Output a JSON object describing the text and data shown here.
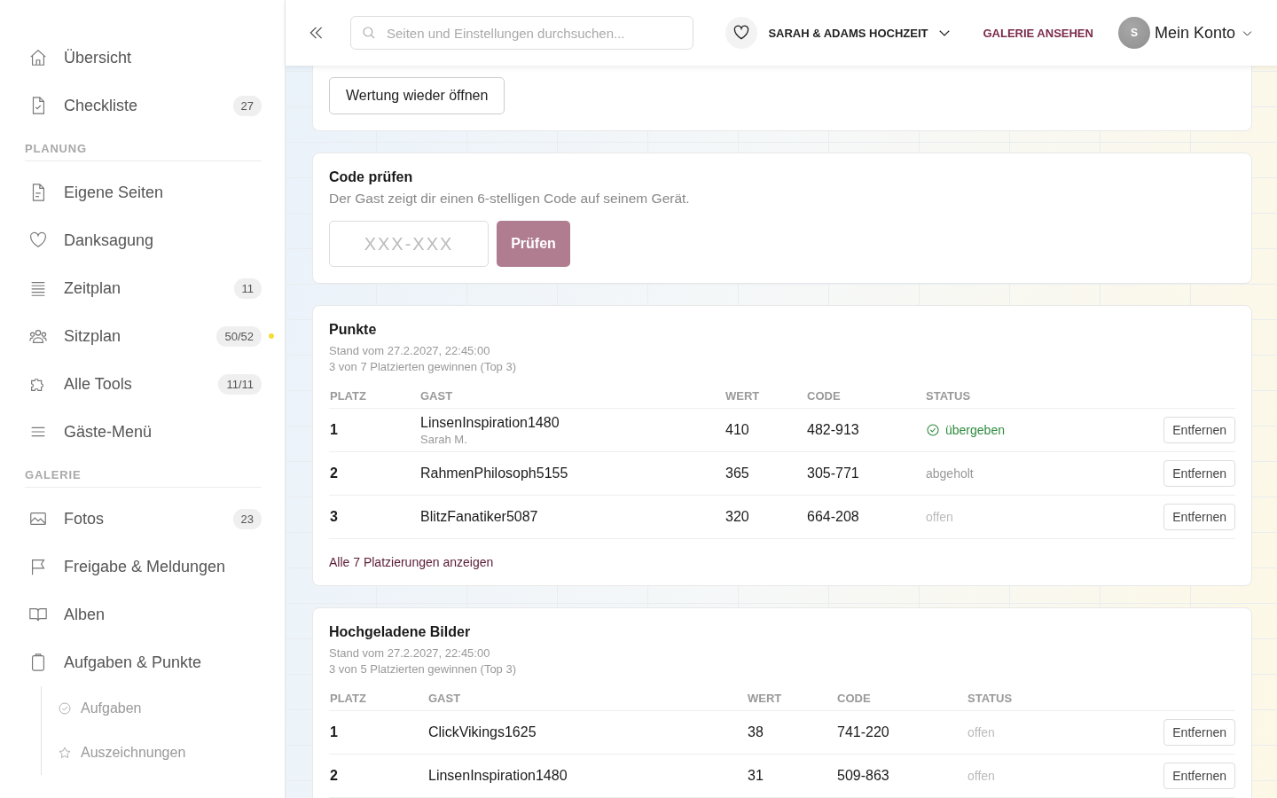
{
  "sidebar": {
    "groups": [
      {
        "items": [
          {
            "label": "Übersicht",
            "selected": false
          },
          {
            "label": "Checkliste",
            "badge": "27",
            "selected": false
          }
        ]
      },
      {
        "heading": "PLANUNG",
        "items": [
          {
            "label": "Eigene Seiten",
            "selected": false
          },
          {
            "label": "Danksagung",
            "selected": false
          },
          {
            "label": "Zeitplan",
            "badge": "11",
            "selected": false
          },
          {
            "label": "Sitzplan",
            "badge": "50/52",
            "color": "#f5dc3a",
            "selected": false
          },
          {
            "label": "Alle Tools",
            "badge": "11/11",
            "selected": false
          },
          {
            "label": "Gäste-Menü",
            "selected": false
          }
        ]
      },
      {
        "heading": "GALERIE",
        "items": [
          {
            "label": "Fotos",
            "badge": "23",
            "selected": false
          },
          {
            "label": "Freigabe & Meldungen",
            "selected": false
          },
          {
            "label": "Alben",
            "selected": false
          },
          {
            "label": "Aufgaben & Punkte",
            "selected": false,
            "expanded": true,
            "children": [
              {
                "label": "Aufgaben",
                "selected": false
              },
              {
                "label": "Auszeichnungen",
                "selected": false
              }
            ]
          }
        ]
      }
    ]
  },
  "header": {
    "search": {
      "placeholder": "Seiten und Einstellungen durchsuchen..."
    },
    "event": "SARAH & ADAMS HOCHZEIT",
    "gallery_link": "GALERIE ANSEHEN",
    "avatar": "S",
    "account": "Mein Konto"
  },
  "reopen_button": "Wertung wieder öffnen",
  "code_check": {
    "title": "Code prüfen",
    "description": "Der Gast zeigt dir einen 6-stelligen Code auf seinem Gerät.",
    "input": {
      "placeholder": "XXX-XXX"
    },
    "button": "Prüfen"
  },
  "rankings": [
    {
      "title": "Punkte",
      "updated": "Stand vom 27.2.2027, 22:45:00",
      "summary": "3 von 7 Platzierten gewinnen (Top 3)",
      "columns": [
        "PLATZ",
        "GAST",
        "WERT",
        "CODE",
        "STATUS"
      ],
      "rows": [
        {
          "place": "1",
          "guest": "LinsenInspiration1480",
          "guest_sub": "Sarah M.",
          "value": "410",
          "code": "482-913",
          "status": "übergeben",
          "kind": "handed",
          "action": "Entfernen"
        },
        {
          "place": "2",
          "guest": "RahmenPhilosoph5155",
          "value": "365",
          "code": "305-771",
          "status": "abgeholt",
          "kind": "collected",
          "action": "Entfernen"
        },
        {
          "place": "3",
          "guest": "BlitzFanatiker5087",
          "value": "320",
          "code": "664-208",
          "status": "offen",
          "kind": "open",
          "action": "Entfernen"
        }
      ],
      "link": "Alle 7 Platzierungen anzeigen"
    },
    {
      "title": "Hochgeladene Bilder",
      "updated": "Stand vom 27.2.2027, 22:45:00",
      "summary": "3 von 5 Platzierten gewinnen (Top 3)",
      "columns": [
        "PLATZ",
        "GAST",
        "WERT",
        "CODE",
        "STATUS"
      ],
      "rows": [
        {
          "place": "1",
          "guest": "ClickVikings1625",
          "value": "38",
          "code": "741-220",
          "status": "offen",
          "kind": "open",
          "action": "Entfernen"
        },
        {
          "place": "2",
          "guest": "LinsenInspiration1480",
          "value": "31",
          "code": "509-863",
          "status": "offen",
          "kind": "open",
          "action": "Entfernen"
        }
      ]
    }
  ]
}
